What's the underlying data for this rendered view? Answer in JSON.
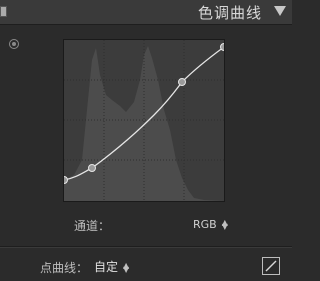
{
  "panel": {
    "title": "色调曲线",
    "collapse_icon": "triangle-down-icon"
  },
  "tools": {
    "target_adjust_icon": "target-icon"
  },
  "curve": {
    "channel": "RGB",
    "points": [
      [
        0.0,
        0.13
      ],
      [
        0.17,
        0.21
      ],
      [
        0.73,
        0.74
      ],
      [
        1.0,
        0.96
      ]
    ]
  },
  "channel": {
    "label": "通道：",
    "value": "RGB"
  },
  "point_curve": {
    "label": "点曲线：",
    "value": "自定",
    "toggle_icon": "edit-curve-icon"
  }
}
